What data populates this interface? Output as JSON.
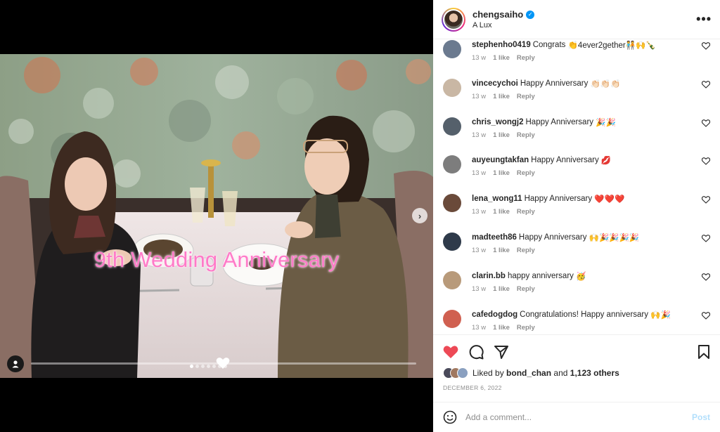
{
  "header": {
    "username": "chengsaiho",
    "location": "A Lux",
    "more_icon": "more-horizontal-icon"
  },
  "media": {
    "overlay_text": "9th Wedding Anniversary",
    "carousel_count": 7,
    "carousel_active": 1,
    "next_icon": "chevron-right-icon"
  },
  "comments": [
    {
      "user": "stephenho0419",
      "text": "Congrats",
      "emoji": "👏4ever2gether🧑‍🤝‍🧑🙌🍾",
      "time": "13 w",
      "likes": "1 like",
      "reply": "Reply",
      "avatar_color": "#6b7a8f"
    },
    {
      "user": "vincecychoi",
      "text": "Happy Anniversary",
      "emoji": "👏🏻👏🏻👏🏻",
      "time": "13 w",
      "likes": "1 like",
      "reply": "Reply",
      "avatar_color": "#c9b7a4"
    },
    {
      "user": "chris_wongj2",
      "text": "Happy Anniversary",
      "emoji": "🎉🎉",
      "time": "13 w",
      "likes": "1 like",
      "reply": "Reply",
      "avatar_color": "#55606b"
    },
    {
      "user": "auyeungtakfan",
      "text": "Happy Anniversary",
      "emoji": "💋",
      "time": "13 w",
      "likes": "1 like",
      "reply": "Reply",
      "avatar_color": "#7d7d7d"
    },
    {
      "user": "lena_wong11",
      "text": "Happy Anniversary",
      "emoji": "❤️❤️❤️",
      "time": "13 w",
      "likes": "1 like",
      "reply": "Reply",
      "avatar_color": "#6a4a3a"
    },
    {
      "user": "madteeth86",
      "text": "Happy Anniversary",
      "emoji": "🙌🎉🎉🎉🎉",
      "time": "13 w",
      "likes": "1 like",
      "reply": "Reply",
      "avatar_color": "#2e3a4a"
    },
    {
      "user": "clarin.bb",
      "text": "happy anniversary",
      "emoji": "🥳",
      "time": "13 w",
      "likes": "1 like",
      "reply": "Reply",
      "avatar_color": "#b89a7a"
    },
    {
      "user": "cafedogdog",
      "text": "Congratulations! Happy anniversary",
      "emoji": "🙌🎉",
      "time": "13 w",
      "likes": "1 like",
      "reply": "Reply",
      "avatar_color": "#d06050"
    }
  ],
  "actions": {
    "like_icon": "heart-filled-icon",
    "comment_icon": "comment-icon",
    "share_icon": "share-icon",
    "save_icon": "bookmark-icon",
    "liked_state": true,
    "accent_color": "#ed4956"
  },
  "likes": {
    "prefix": "Liked by",
    "user": "bond_chan",
    "and": "and",
    "others": "1,123 others"
  },
  "date": "DECEMBER 6, 2022",
  "add_comment": {
    "placeholder": "Add a comment...",
    "post_label": "Post",
    "emoji_icon": "smiley-icon"
  }
}
